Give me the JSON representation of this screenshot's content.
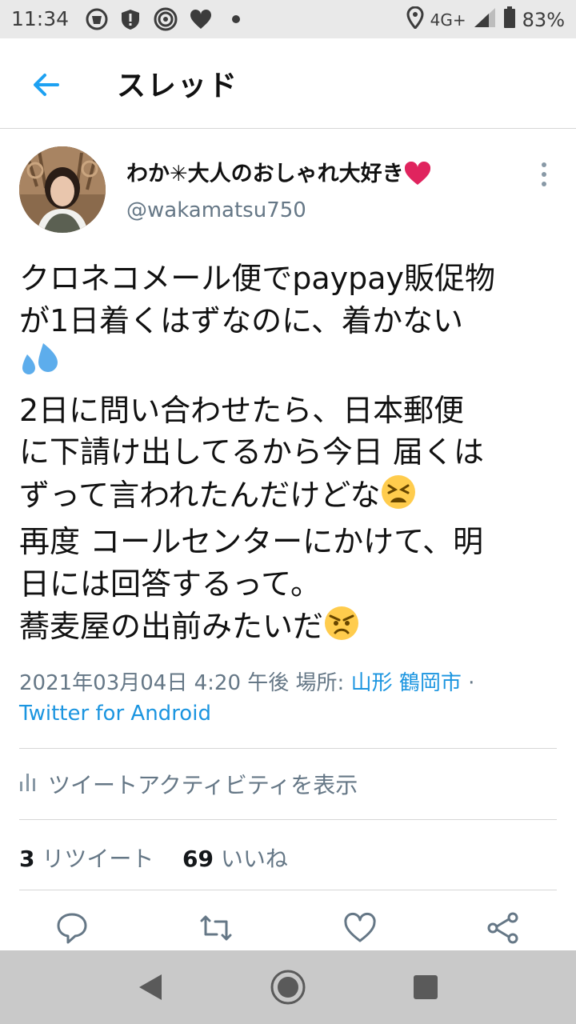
{
  "status_bar": {
    "time": "11:34",
    "network": "4G+",
    "battery": "83%",
    "icons": [
      "notification-cup-icon",
      "shield-alert-icon",
      "nfc-icon",
      "heart-icon",
      "dot-icon",
      "location-icon",
      "signal-icon",
      "battery-icon"
    ]
  },
  "header": {
    "title": "スレッド",
    "back_icon": "arrow-left-icon"
  },
  "tweet": {
    "display_name": "わか✳大人のおしゃれ大好き",
    "name_emoji": "❤️",
    "handle": "@wakamatsu750",
    "lines": [
      {
        "text": "クロネコメール便でpaypay販促物"
      },
      {
        "text": "が1日着くはずなのに、着かない"
      },
      {
        "text": "",
        "emoji": "sweat-droplets"
      },
      {
        "text": "2日に問い合わせたら、日本郵便"
      },
      {
        "text": "に下請け出してるから今日 届くは"
      },
      {
        "text": "ずって言われたんだけどな",
        "emoji": "tired-face"
      },
      {
        "text": "再度 コールセンターにかけて、明"
      },
      {
        "text": "日には回答するって。"
      },
      {
        "text": "蕎麦屋の出前みたいだ",
        "emoji": "angry-face"
      }
    ],
    "timestamp": "2021年03月04日 4:20 午後",
    "location_label": "場所: ",
    "location": "山形 鶴岡市",
    "separator": " ·",
    "source": "Twitter for Android",
    "activity_label": "ツイートアクティビティを表示",
    "retweet_count": "3",
    "retweet_label": "リツイート",
    "like_count": "69",
    "like_label": "いいね"
  },
  "actions": [
    "reply-icon",
    "retweet-icon",
    "like-icon",
    "share-icon"
  ],
  "nav": [
    "back-triangle-icon",
    "home-circle-icon",
    "recents-square-icon"
  ],
  "colors": {
    "accent": "#1da1f2",
    "link": "#1b95e0",
    "secondary_text": "#657786",
    "divider": "#d6d6d6",
    "status_bar_bg": "#e9e9e9",
    "nav_bar_bg": "#c9c9c9"
  }
}
